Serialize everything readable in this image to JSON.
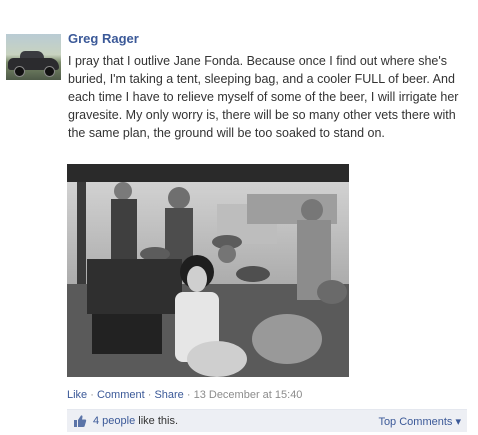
{
  "post": {
    "author": "Greg Rager",
    "message": "I pray that I outlive Jane Fonda. Because once I find out where she's buried, I'm taking a tent, sleeping bag, and a cooler FULL of beer. And each time I have to relieve myself of some of the beer, I will irrigate her gravesite. My only worry is, there will be so many other vets there with the same plan, the ground will be too soaked to stand on."
  },
  "actions": {
    "like": "Like",
    "separator": " · ",
    "comment": "Comment",
    "share": "Share",
    "timestamp": "13 December at 15:40"
  },
  "likes": {
    "count_label": "4 people",
    "suffix": " like this.",
    "sort_label": "Top Comments ▾"
  },
  "colors": {
    "link": "#3b5998",
    "likes_bar": "#edeff4"
  }
}
